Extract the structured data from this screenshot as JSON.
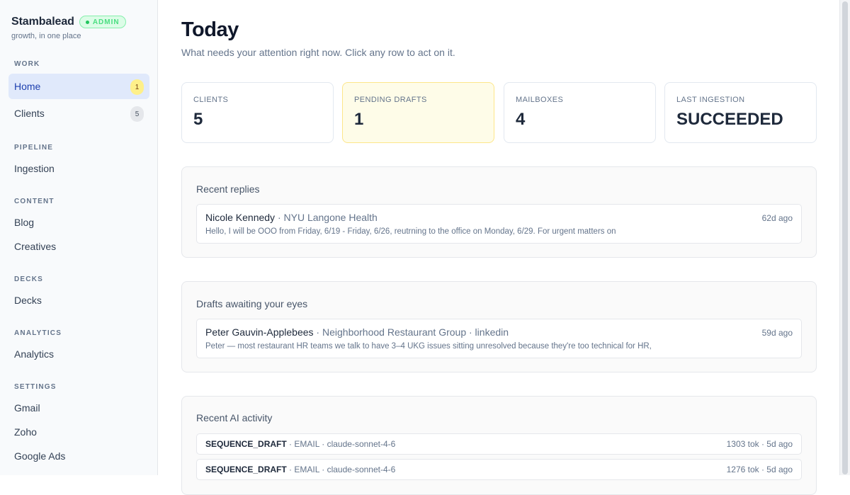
{
  "brand": {
    "name": "Stambalead",
    "badge": "ADMIN",
    "tagline": "growth, in one place"
  },
  "sidebar": {
    "sections": [
      {
        "label": "WORK",
        "items": [
          {
            "label": "Home",
            "badge": "1"
          },
          {
            "label": "Clients",
            "badge": "5"
          }
        ]
      },
      {
        "label": "PIPELINE",
        "items": [
          {
            "label": "Ingestion"
          }
        ]
      },
      {
        "label": "CONTENT",
        "items": [
          {
            "label": "Blog"
          },
          {
            "label": "Creatives"
          }
        ]
      },
      {
        "label": "DECKS",
        "items": [
          {
            "label": "Decks"
          }
        ]
      },
      {
        "label": "ANALYTICS",
        "items": [
          {
            "label": "Analytics"
          }
        ]
      },
      {
        "label": "SETTINGS",
        "items": [
          {
            "label": "Gmail"
          },
          {
            "label": "Zoho"
          },
          {
            "label": "Google Ads"
          }
        ]
      }
    ]
  },
  "header": {
    "title": "Today",
    "subtitle": "What needs your attention right now. Click any row to act on it."
  },
  "stats": [
    {
      "label": "CLIENTS",
      "value": "5"
    },
    {
      "label": "PENDING DRAFTS",
      "value": "1"
    },
    {
      "label": "MAILBOXES",
      "value": "4"
    },
    {
      "label": "LAST INGESTION",
      "value": "SUCCEEDED"
    }
  ],
  "recent_replies": {
    "title": "Recent replies",
    "rows": [
      {
        "name": "Nicole Kennedy",
        "meta": " · NYU Langone Health",
        "time": "62d ago",
        "snippet": "Hello, I will be OOO from Friday, 6/19 - Friday, 6/26, reutrning to the office on Monday, 6/29. For urgent matters on"
      }
    ]
  },
  "drafts": {
    "title": "Drafts awaiting your eyes",
    "rows": [
      {
        "name": "Peter Gauvin-Applebees",
        "meta": " · Neighborhood Restaurant Group · linkedin",
        "time": "59d ago",
        "snippet": "Peter — most restaurant HR teams we talk to have 3–4 UKG issues sitting unresolved because they're too technical for HR,"
      }
    ]
  },
  "ai_activity": {
    "title": "Recent AI activity",
    "rows": [
      {
        "kind": "SEQUENCE_DRAFT",
        "meta": " · EMAIL · claude-sonnet-4-6",
        "right": "1303 tok · 5d ago"
      },
      {
        "kind": "SEQUENCE_DRAFT",
        "meta": " · EMAIL · claude-sonnet-4-6",
        "right": "1276 tok · 5d ago"
      }
    ]
  }
}
